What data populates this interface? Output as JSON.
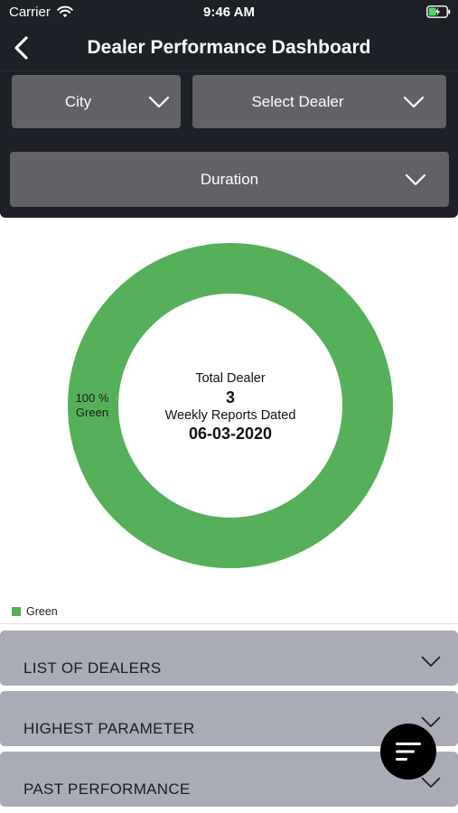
{
  "status_bar": {
    "carrier": "Carrier",
    "time": "9:46 AM",
    "icons": [
      "wifi-icon",
      "battery-charging-icon"
    ]
  },
  "nav": {
    "back_icon": "chevron-left-icon",
    "title": "Dealer Performance Dashboard"
  },
  "filters": {
    "city": "City",
    "dealer": "Select Dealer",
    "duration": "Duration",
    "icon": "chevron-down-icon"
  },
  "chart_data": {
    "type": "pie",
    "categories": [
      "Green"
    ],
    "values": [
      100
    ],
    "slice_labels": [
      {
        "percent": "100 %",
        "name": "Green"
      }
    ],
    "colors": [
      "#56b05a"
    ],
    "legend": [
      "Green"
    ],
    "legend_position": "bottom-left",
    "center": {
      "line1": "Total Dealer",
      "line2": "3",
      "line3": "Weekly Reports Dated",
      "line4": "06-03-2020"
    }
  },
  "sections": [
    {
      "title": "LIST OF DEALERS"
    },
    {
      "title": "HIGHEST PARAMETER"
    },
    {
      "title": "PAST PERFORMANCE"
    }
  ],
  "fab": {
    "icon": "sort-lines-icon"
  },
  "colors": {
    "header_bg": "#1d2026",
    "dropdown_bg": "#616166",
    "accordion_bg": "#a9acb7",
    "chart_green": "#56b05a",
    "fab_bg": "#000000"
  }
}
